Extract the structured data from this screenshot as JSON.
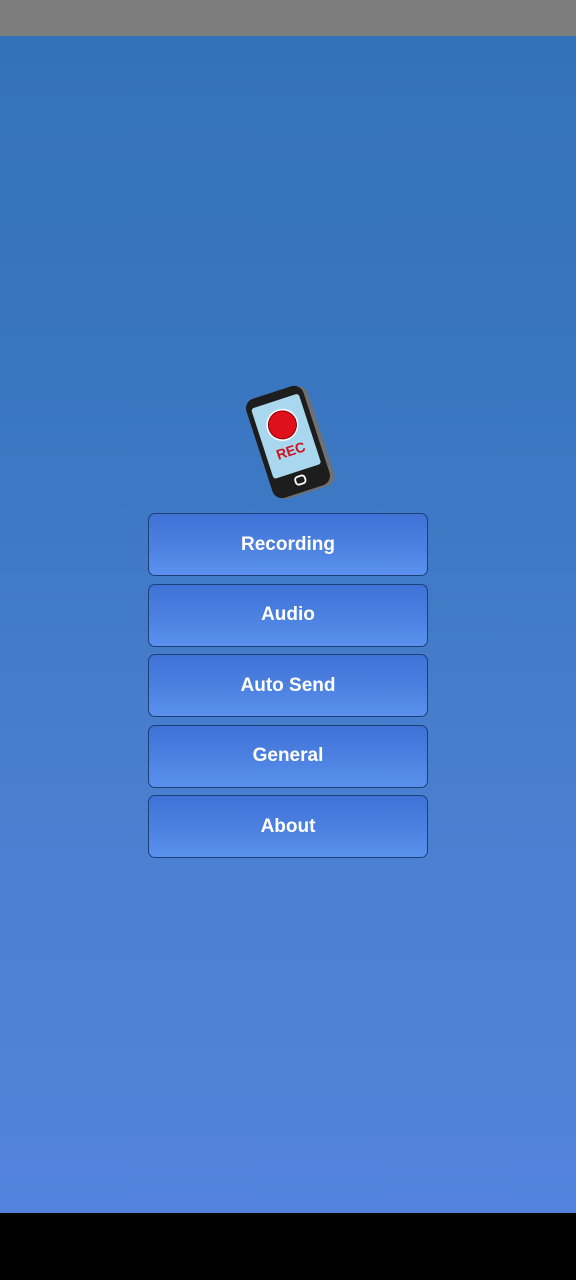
{
  "logo": {
    "icon": "phone-recording-icon",
    "text": "REC",
    "colors": {
      "record": "#e0101a",
      "screen": "#a9d8ee",
      "body": "#1d1d1d"
    }
  },
  "menu": {
    "recording_label": "Recording",
    "audio_label": "Audio",
    "auto_send_label": "Auto Send",
    "general_label": "General",
    "about_label": "About"
  },
  "colors": {
    "status_bar": "#7d7d7d",
    "background_top": "#3472b8",
    "background_bottom": "#5383dc",
    "button_border": "#1c3f7a",
    "button_text": "#ffffff"
  }
}
